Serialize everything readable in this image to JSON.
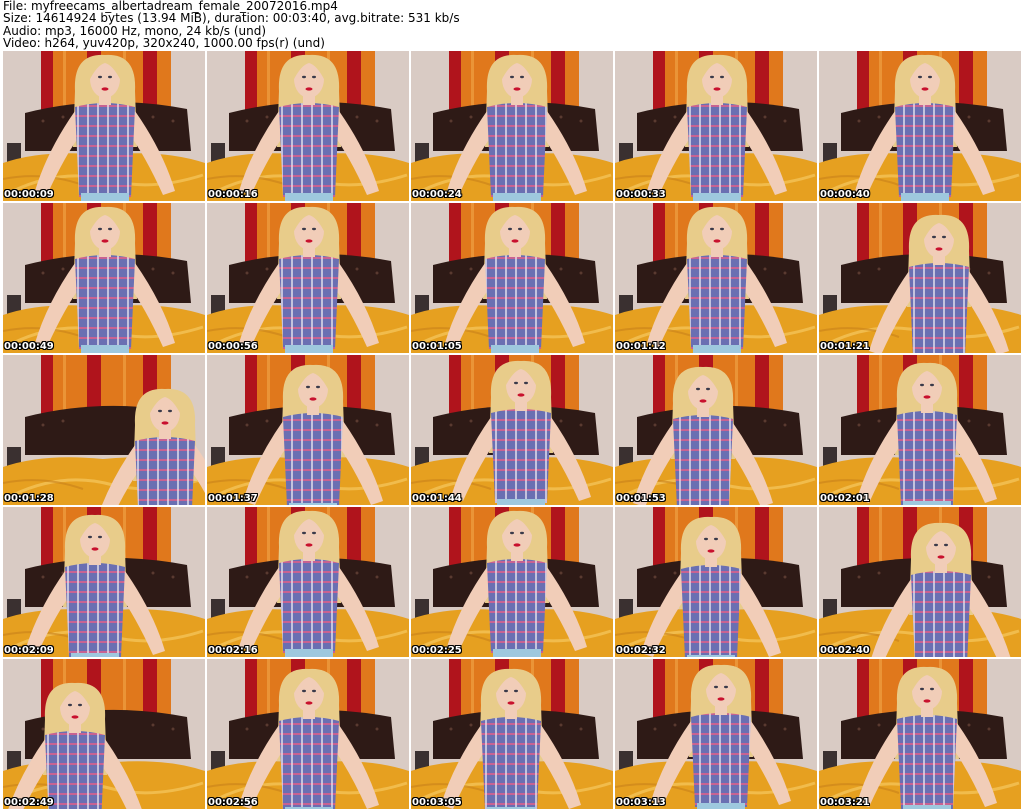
{
  "header": {
    "file_line": "File: myfreecams_albertadream_female_20072016.mp4",
    "size_line": "Size: 14614924 bytes (13.94 MiB), duration: 00:03:40, avg.bitrate: 531 kb/s",
    "audio_line": "Audio: mp3, 16000 Hz, mono, 24 kb/s (und)",
    "video_line": "Video: h264, yuv420p, 320x240, 1000.00 fps(r) (und)"
  },
  "frames": [
    {
      "timestamp": "00:00:09"
    },
    {
      "timestamp": "00:00:16"
    },
    {
      "timestamp": "00:00:24"
    },
    {
      "timestamp": "00:00:33"
    },
    {
      "timestamp": "00:00:40"
    },
    {
      "timestamp": "00:00:49"
    },
    {
      "timestamp": "00:00:56"
    },
    {
      "timestamp": "00:01:05"
    },
    {
      "timestamp": "00:01:12"
    },
    {
      "timestamp": "00:01:21"
    },
    {
      "timestamp": "00:01:28"
    },
    {
      "timestamp": "00:01:37"
    },
    {
      "timestamp": "00:01:44"
    },
    {
      "timestamp": "00:01:53"
    },
    {
      "timestamp": "00:02:01"
    },
    {
      "timestamp": "00:02:09"
    },
    {
      "timestamp": "00:02:16"
    },
    {
      "timestamp": "00:02:25"
    },
    {
      "timestamp": "00:02:32"
    },
    {
      "timestamp": "00:02:40"
    },
    {
      "timestamp": "00:02:49"
    },
    {
      "timestamp": "00:02:56"
    },
    {
      "timestamp": "00:03:05"
    },
    {
      "timestamp": "00:03:13"
    },
    {
      "timestamp": "00:03:21"
    }
  ],
  "colors": {
    "wall": "#d9cbc4",
    "curtain_orange": "#e0781c",
    "curtain_red": "#b0141c",
    "headboard": "#2e1a16",
    "bedspread": "#e6a020",
    "hair": "#e8cc8a",
    "skin": "#f1cdb8",
    "shirt": "#6a6fb2",
    "shirt_check": "#d95f8c",
    "timestamp_text": "#ffffff"
  }
}
